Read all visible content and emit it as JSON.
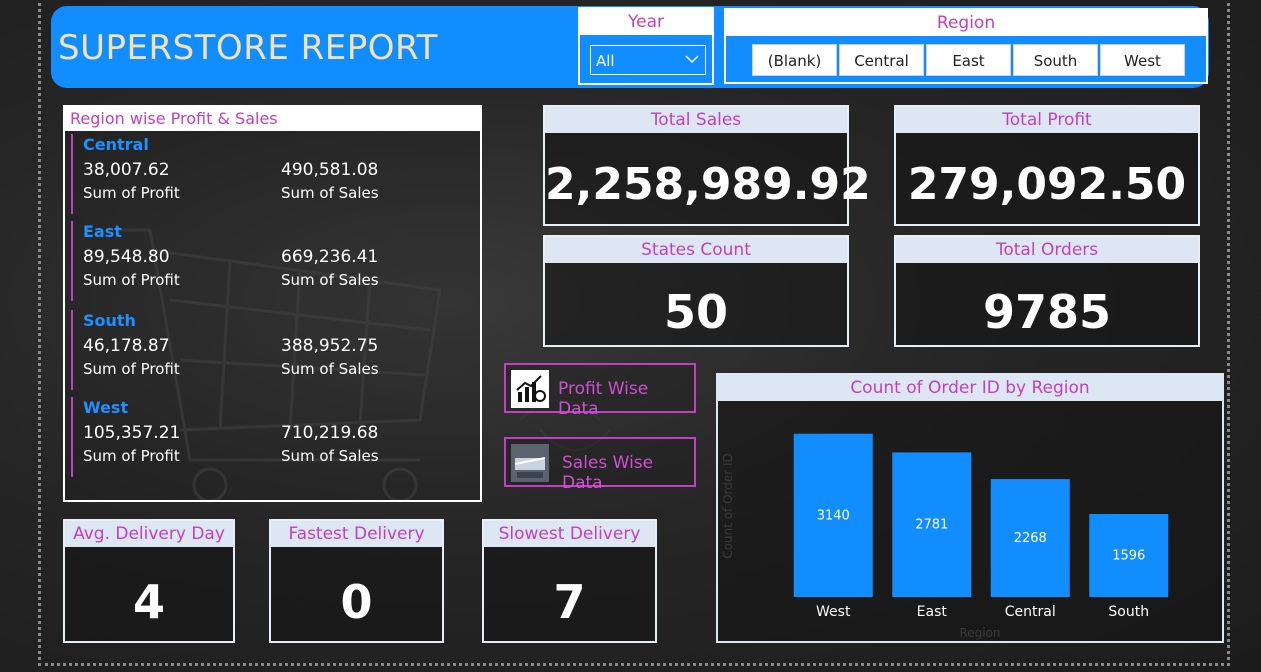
{
  "header": {
    "title": "SUPERSTORE REPORT",
    "year_label": "Year",
    "year_value": "All",
    "region_label": "Region",
    "region_buttons": [
      "(Blank)",
      "Central",
      "East",
      "South",
      "West"
    ]
  },
  "region_card": {
    "title": "Region wise Profit & Sales",
    "groups": [
      {
        "name": "Central",
        "profit": "38,007.62",
        "profit_label": "Sum of Profit",
        "sales": "490,581.08",
        "sales_label": "Sum of Sales"
      },
      {
        "name": "East",
        "profit": "89,548.80",
        "profit_label": "Sum of Profit",
        "sales": "669,236.41",
        "sales_label": "Sum of Sales"
      },
      {
        "name": "South",
        "profit": "46,178.87",
        "profit_label": "Sum of Profit",
        "sales": "388,952.75",
        "sales_label": "Sum of Sales"
      },
      {
        "name": "West",
        "profit": "105,357.21",
        "profit_label": "Sum of Profit",
        "sales": "710,219.68",
        "sales_label": "Sum of Sales"
      }
    ]
  },
  "kpis": {
    "total_sales": {
      "label": "Total Sales",
      "value": "2,258,989.92"
    },
    "total_profit": {
      "label": "Total Profit",
      "value": "279,092.50"
    },
    "states_count": {
      "label": "States Count",
      "value": "50"
    },
    "total_orders": {
      "label": "Total Orders",
      "value": "9785"
    },
    "avg_delivery": {
      "label": "Avg. Delivery Day",
      "value": "4"
    },
    "fastest_delivery": {
      "label": "Fastest Delivery",
      "value": "0"
    },
    "slowest_delivery": {
      "label": "Slowest Delivery",
      "value": "7"
    }
  },
  "buttons": {
    "profit_wise": "Profit Wise Data",
    "sales_wise": "Sales Wise Data"
  },
  "icons": {
    "profit_wise": "bar-chart-icon",
    "sales_wise": "sales-image-icon",
    "year_dropdown": "chevron-down-icon"
  },
  "colors": {
    "accent": "#118dff",
    "label": "#c13fc1",
    "bar": "#118dff"
  },
  "chart_data": {
    "type": "bar",
    "title": "Count of Order ID by Region",
    "categories": [
      "West",
      "East",
      "Central",
      "South"
    ],
    "values": [
      3140,
      2781,
      2268,
      1596
    ],
    "xlabel": "Region",
    "ylabel": "Count of Order ID",
    "ylim": [
      0,
      3500
    ],
    "grid": false
  }
}
